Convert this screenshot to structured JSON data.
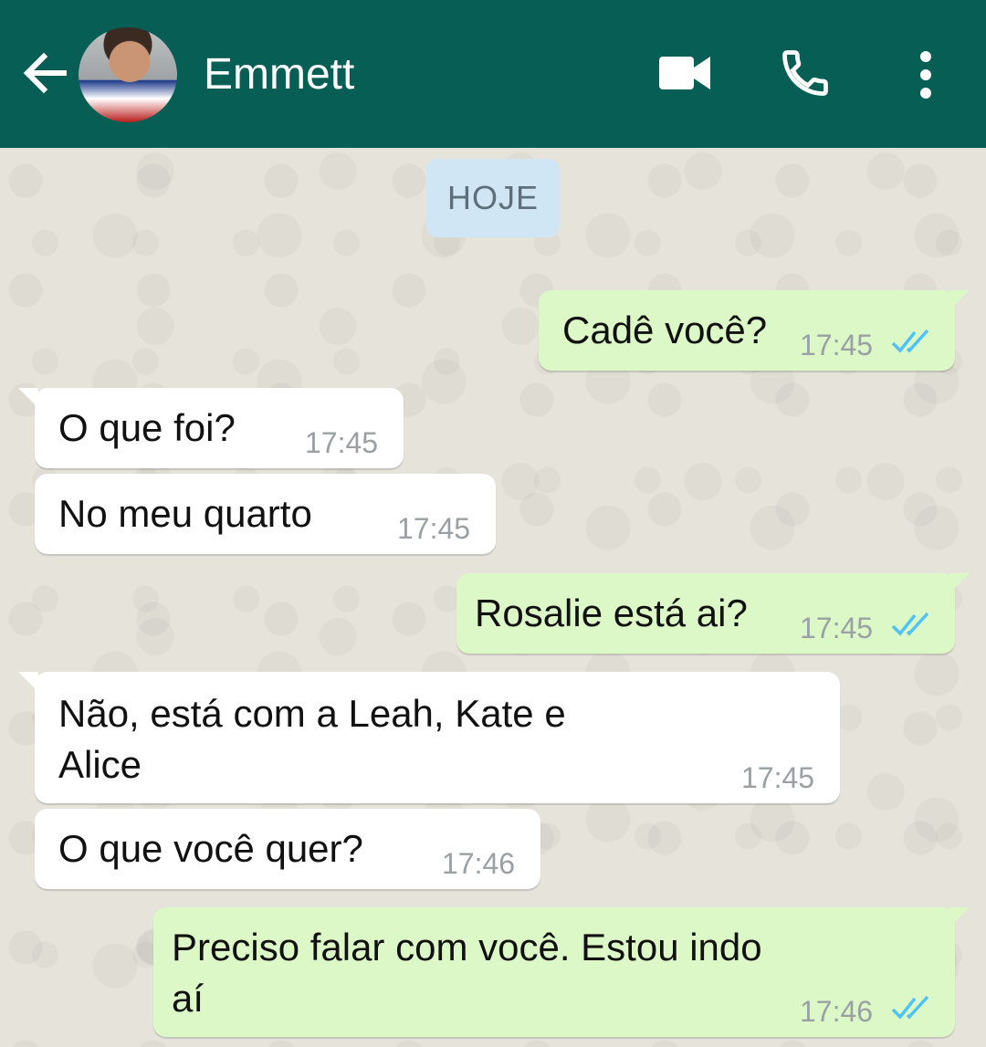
{
  "header": {
    "contact_name": "Emmett",
    "bar_color": "#075e54"
  },
  "chat": {
    "date_label": "HOJE",
    "messages": [
      {
        "direction": "out",
        "text": "Cadê você?",
        "time": "17:45",
        "status": "read"
      },
      {
        "direction": "in",
        "text": "O que foi?",
        "time": "17:45"
      },
      {
        "direction": "in",
        "text": "No meu quarto",
        "time": "17:45"
      },
      {
        "direction": "out",
        "text": "Rosalie está ai?",
        "time": "17:45",
        "status": "read"
      },
      {
        "direction": "in",
        "text_line1": "Não, está com a Leah, Kate e",
        "text_line2": "Alice",
        "time": "17:45"
      },
      {
        "direction": "in",
        "text": "O que você quer?",
        "time": "17:46"
      },
      {
        "direction": "out",
        "text_line1": "Preciso falar com você. Estou indo",
        "text_line2": "aí",
        "time": "17:46",
        "status": "read"
      }
    ]
  },
  "colors": {
    "outgoing_bubble": "#dcf8c6",
    "incoming_bubble": "#ffffff",
    "read_ticks": "#4fc3f7",
    "date_chip": "#d0e6f4"
  },
  "icons": [
    "back-arrow-icon",
    "video-call-icon",
    "phone-icon",
    "more-vert-icon",
    "double-check-icon"
  ]
}
